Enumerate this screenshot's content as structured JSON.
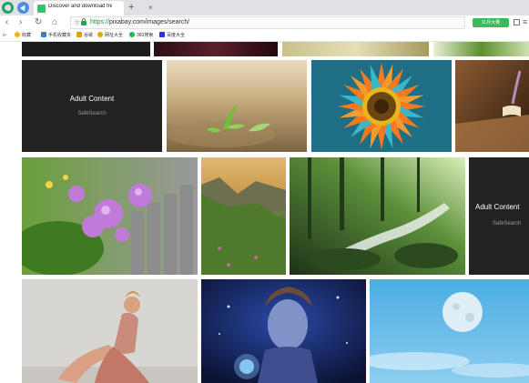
{
  "browser": {
    "tab_title": "Discover and download free",
    "tab_close": "×",
    "new_tab": "+",
    "url_scheme": "https://",
    "url_rest": "pixabay.com/images/search/",
    "badge": "11月大赛",
    "menu_glyph": "≡",
    "nav": {
      "back": "‹",
      "forward": "›",
      "reload": "↻",
      "home": "⌂",
      "bookmark_star": "☆"
    }
  },
  "bookmarks": [
    {
      "label": "收藏",
      "icon": "star-icon",
      "color": "#f5b400"
    },
    {
      "label": "手机收藏夹",
      "icon": "folder-icon",
      "color": "#3a7bd5"
    },
    {
      "label": "谷歌",
      "icon": "folder-icon",
      "color": "#d9a400"
    },
    {
      "label": "网址大全",
      "icon": "globe-icon",
      "color": "#e8a800"
    },
    {
      "label": "360搜索",
      "icon": "search-icon",
      "color": "#2bb24c"
    },
    {
      "label": "百度大全",
      "icon": "baidu-icon",
      "color": "#2932e1"
    }
  ],
  "grid": {
    "adult_title": "Adult Content",
    "adult_sub": "SafeSearch",
    "images": [
      {
        "name": "seedling-image",
        "colors": [
          "#d9c39a",
          "#8f7651",
          "#5a4a30"
        ]
      },
      {
        "name": "orange-flower-image",
        "colors": [
          "#f47a1f",
          "#2d9fb8",
          "#5b3a12"
        ]
      },
      {
        "name": "book-image",
        "colors": [
          "#6b4a31",
          "#b58659",
          "#3a2616"
        ]
      },
      {
        "name": "purple-flowers-image",
        "colors": [
          "#6a9f3b",
          "#c07ad8",
          "#4b6b2a"
        ]
      },
      {
        "name": "valley-image",
        "colors": [
          "#c99a4c",
          "#5d7d3a",
          "#2f4a21"
        ]
      },
      {
        "name": "forest-stream-image",
        "colors": [
          "#2f5a2a",
          "#8fb86a",
          "#1d3318"
        ]
      },
      {
        "name": "woman-sitting-image",
        "colors": [
          "#dcdad6",
          "#c28e79",
          "#b2b0ac"
        ]
      },
      {
        "name": "fantasy-woman-image",
        "colors": [
          "#1b2a6b",
          "#6fb2e8",
          "#0b1233"
        ]
      },
      {
        "name": "moon-sky-image",
        "colors": [
          "#56b4e6",
          "#8ccdf0",
          "#dfeef7"
        ]
      }
    ]
  }
}
